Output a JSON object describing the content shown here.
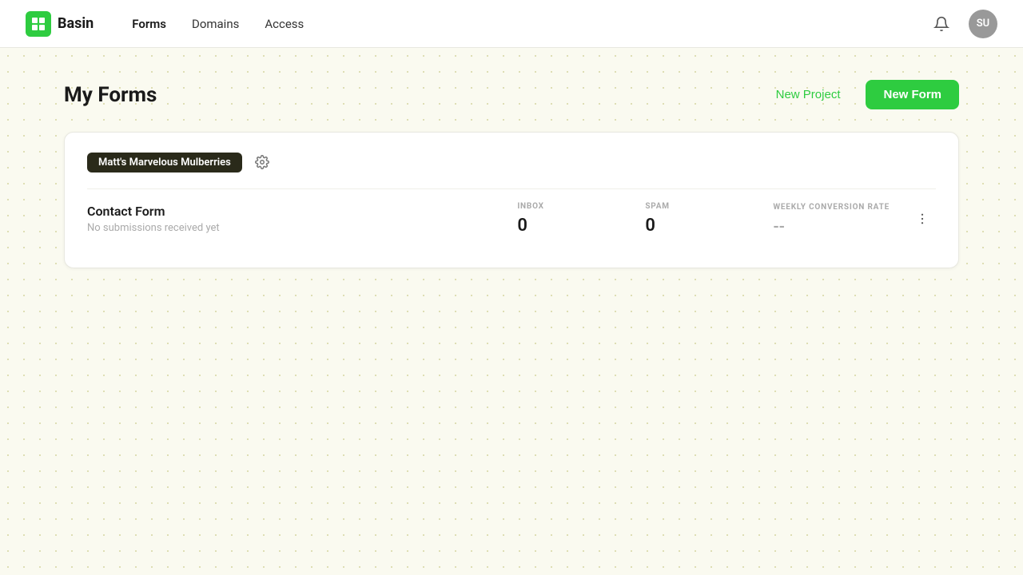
{
  "app": {
    "name": "Basin",
    "logo_alt": "Basin logo"
  },
  "navbar": {
    "links": [
      {
        "label": "Forms",
        "active": true
      },
      {
        "label": "Domains",
        "active": false
      },
      {
        "label": "Access",
        "active": false
      }
    ],
    "avatar_initials": "SU"
  },
  "page": {
    "title": "My Forms",
    "new_project_label": "New Project",
    "new_form_label": "New Form"
  },
  "projects": [
    {
      "name": "Matt's Marvelous Mulberries",
      "forms": [
        {
          "name": "Contact Form",
          "subtitle": "No submissions received yet",
          "inbox_label": "INBOX",
          "inbox_value": "0",
          "spam_label": "SPAM",
          "spam_value": "0",
          "conversion_label": "WEEKLY CONVERSION RATE",
          "conversion_value": "--"
        }
      ]
    }
  ]
}
